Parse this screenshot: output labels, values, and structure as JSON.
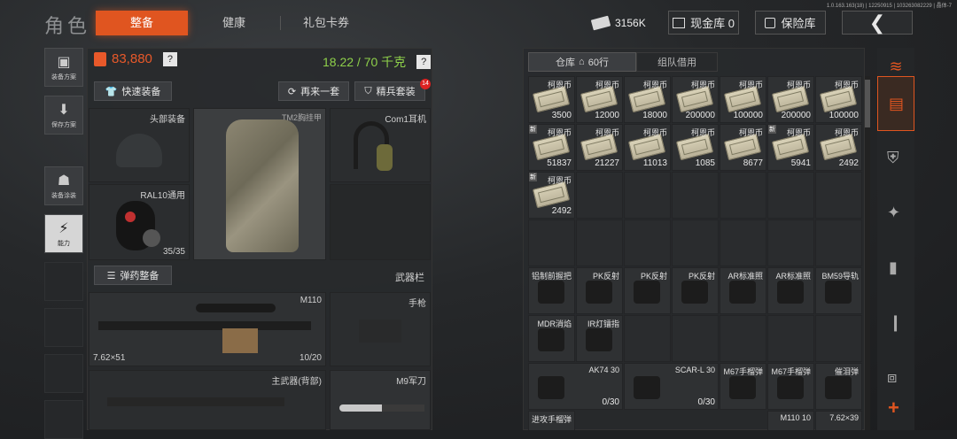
{
  "version": "1.0.163.163(18) | 12250915 | 103263082229 | 晶体-7",
  "header": {
    "title": "角色",
    "tabs": [
      "整备",
      "健康",
      "礼包卡券"
    ],
    "currency": "3156K",
    "cash_label": "现金库 0",
    "safe_label": "保险库"
  },
  "rail": [
    {
      "label": "装备方案"
    },
    {
      "label": "保存方案"
    },
    {
      "label": "装备涂装"
    },
    {
      "label": "能力"
    }
  ],
  "loadout": {
    "value": "83,880",
    "weight": "18.22 / 70 千克",
    "quick_equip": "快速装备",
    "again": "再来一套",
    "elite": "精兵套装",
    "elite_badge": "14",
    "slots": {
      "head": "头部装备",
      "armor": "TM2胸挂甲",
      "ear": "Com1耳机",
      "mask": "RAL10通用",
      "mask_dur": "35/35"
    },
    "ammo_btn": "弹药整备",
    "weapon_bar": "武器栏",
    "primary": {
      "name": "M110",
      "caliber": "7.62×51",
      "ammo": "10/20"
    },
    "pistol": "手枪",
    "back": "主武器(背部)",
    "knife": "M9军刀"
  },
  "storage": {
    "tab_warehouse": "仓库",
    "rows": "60行",
    "tab_team": "组队借用",
    "money_row1": [
      "3500",
      "12000",
      "18000",
      "200000",
      "100000",
      "200000",
      "100000"
    ],
    "money_row2": [
      "51837",
      "21227",
      "11013",
      "1085",
      "8677",
      "5941",
      "2492"
    ],
    "money_row3": [
      "2492"
    ],
    "money_name": "柯恩币",
    "new_tag": "新",
    "attach_row": [
      "铝制前握把",
      "PK反射",
      "PK反射",
      "PK反射",
      "AR标准照",
      "AR标准照",
      "BM59导轨"
    ],
    "attach_row2": [
      "MDR消焰",
      "IR灯镭指"
    ],
    "mag_row": [
      {
        "name": "AK74 30",
        "count": "0/30"
      },
      {
        "name": "SCAR-L 30",
        "count": "0/30"
      },
      {
        "name": "M67手榴弹",
        "count": ""
      },
      {
        "name": "M67手榴弹",
        "count": ""
      },
      {
        "name": "催泪弹",
        "count": ""
      }
    ],
    "bottom_row": [
      "进攻手榴弹",
      "M110 10",
      "7.62×39"
    ]
  }
}
